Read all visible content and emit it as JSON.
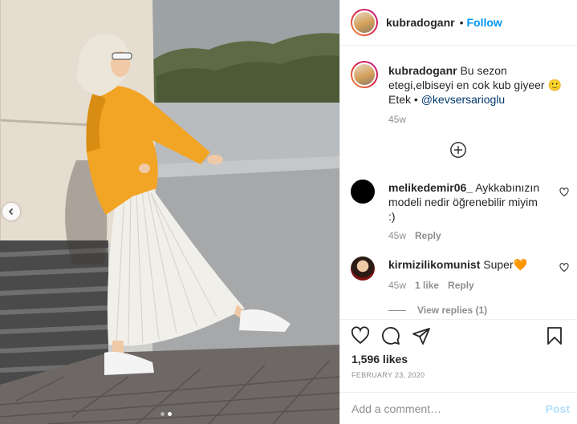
{
  "post": {
    "image_alt": "Woman in orange sweater, white headscarf and white pleated skirt leaning on a wall",
    "carousel": {
      "dots": 2,
      "active_index": 1
    }
  },
  "header": {
    "username": "kubradoganr",
    "separator": "•",
    "follow_label": "Follow"
  },
  "caption": {
    "username": "kubradoganr",
    "text": "Bu sezon etegi,elbiseyi en cok kub giyeer 🙂 Etek •",
    "mention": "@kevsersarioglu",
    "time": "45w"
  },
  "comments": [
    {
      "username": "melikedemir06_",
      "text": "Aykkabınızın modeli nedir öğrenebilir miyim :)",
      "time": "45w",
      "likes": "",
      "reply_label": "Reply"
    },
    {
      "username": "kirmizilikomunist",
      "text": "Super🧡",
      "time": "45w",
      "likes": "1 like",
      "reply_label": "Reply"
    }
  ],
  "view_replies_label": "View replies (1)",
  "likes_text": "1,596 likes",
  "date_text": "February 23, 2020",
  "add_comment": {
    "placeholder": "Add a comment…",
    "post_label": "Post"
  },
  "icons": [
    "chevron-left-icon",
    "add-circle-icon",
    "heart-icon",
    "comment-icon",
    "share-icon",
    "bookmark-icon"
  ],
  "colors": {
    "accent": "#0095f6",
    "post_disabled": "#b2dffc",
    "secondary_text": "#8e8e8e",
    "mention": "#00376b"
  }
}
